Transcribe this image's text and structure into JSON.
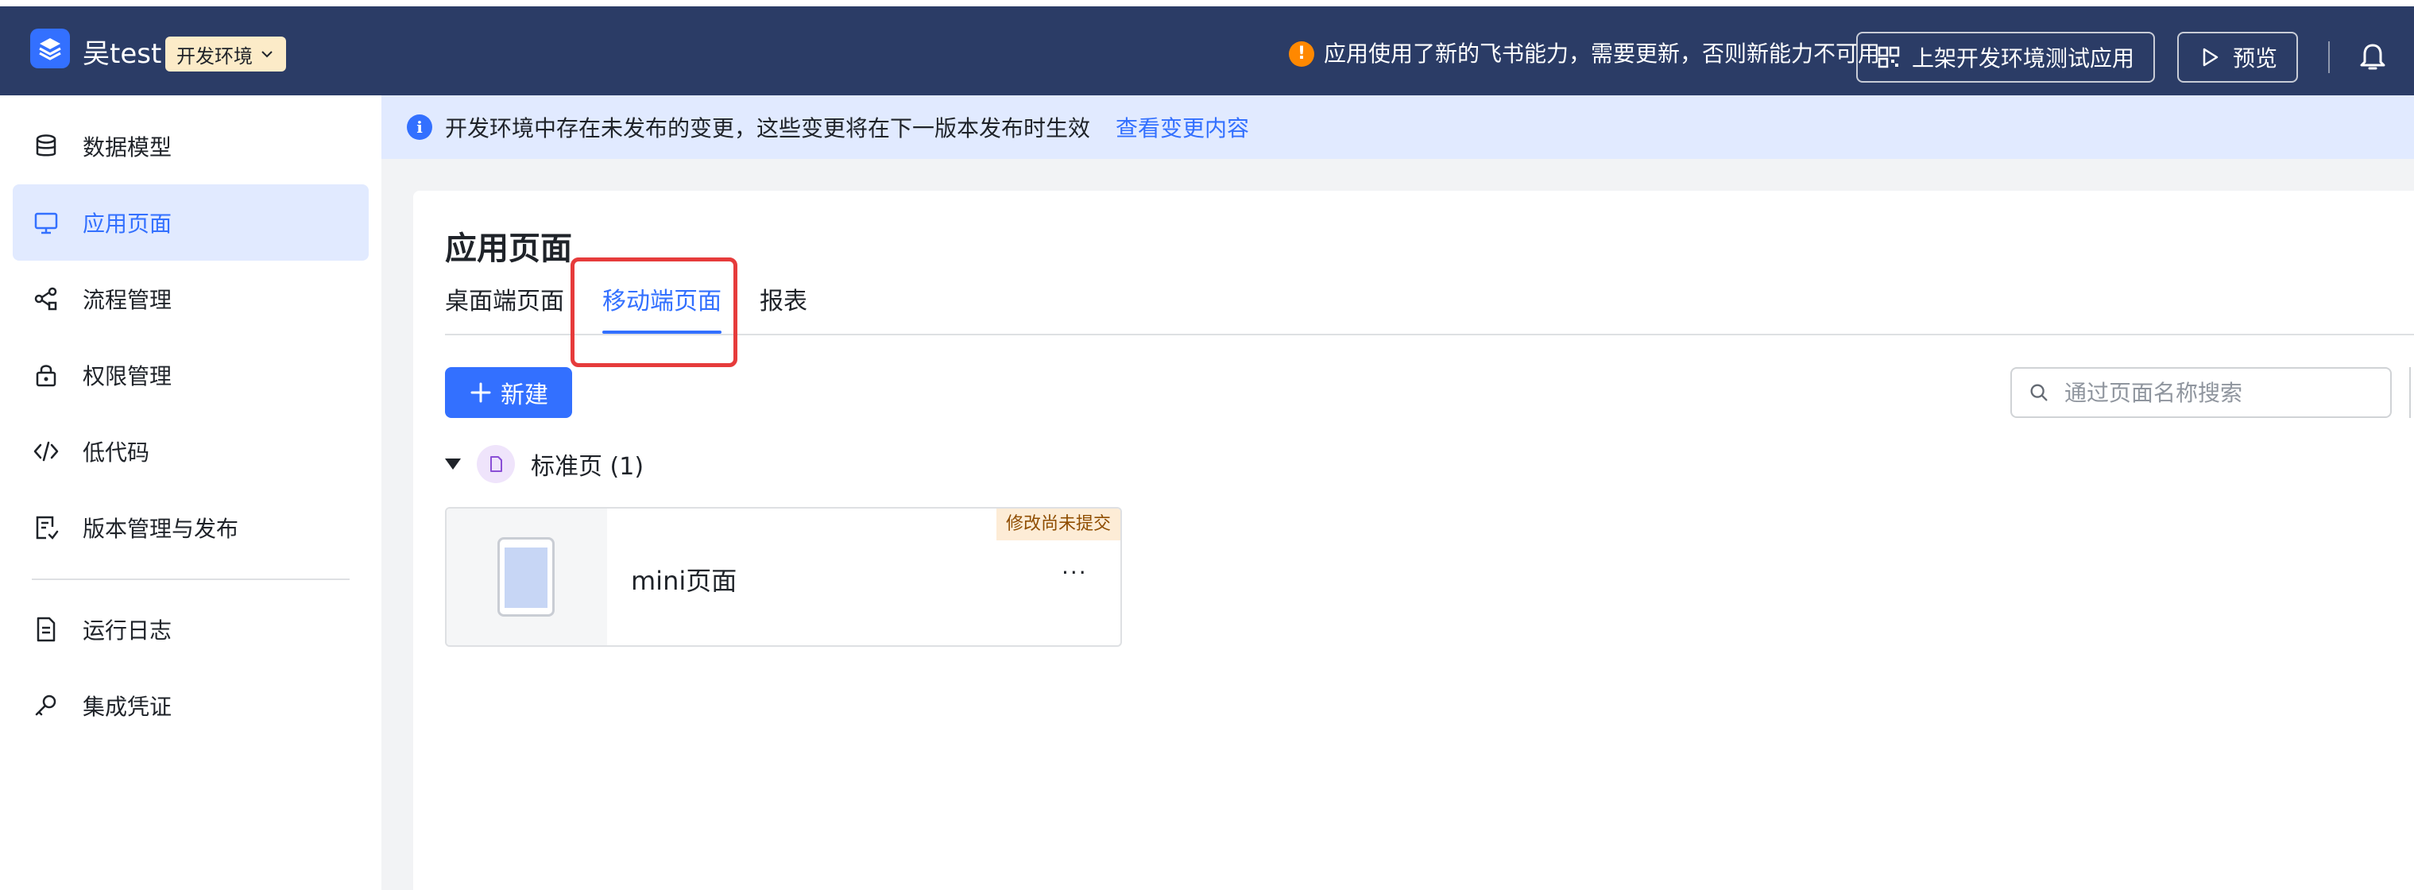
{
  "header": {
    "app_name": "吴test",
    "env_label": "开发环境",
    "notice": "应用使用了新的飞书能力，需要更新，否则新能力不可用",
    "publish_test_label": "上架开发环境测试应用",
    "preview_label": "预览"
  },
  "sidebar": {
    "items": [
      {
        "label": "数据模型"
      },
      {
        "label": "应用页面"
      },
      {
        "label": "流程管理"
      },
      {
        "label": "权限管理"
      },
      {
        "label": "低代码"
      },
      {
        "label": "版本管理与发布"
      },
      {
        "label": "运行日志"
      },
      {
        "label": "集成凭证"
      }
    ],
    "active_index": 1
  },
  "info_bar": {
    "text": "开发环境中存在未发布的变更，这些变更将在下一版本发布时生效",
    "link": "查看变更内容"
  },
  "main": {
    "title": "应用页面",
    "tabs": [
      {
        "label": "桌面端页面"
      },
      {
        "label": "移动端页面"
      },
      {
        "label": "报表"
      }
    ],
    "active_tab": 1,
    "new_button": "新建",
    "search_placeholder": "通过页面名称搜索",
    "group": {
      "title": "标准页 (1)"
    },
    "cards": [
      {
        "name": "mini页面",
        "badge": "修改尚未提交",
        "more": "···"
      }
    ]
  },
  "colors": {
    "accent": "#3370ff",
    "topbar": "#2b3c66",
    "highlight": "#e63b3b",
    "warning": "#ff8800"
  }
}
